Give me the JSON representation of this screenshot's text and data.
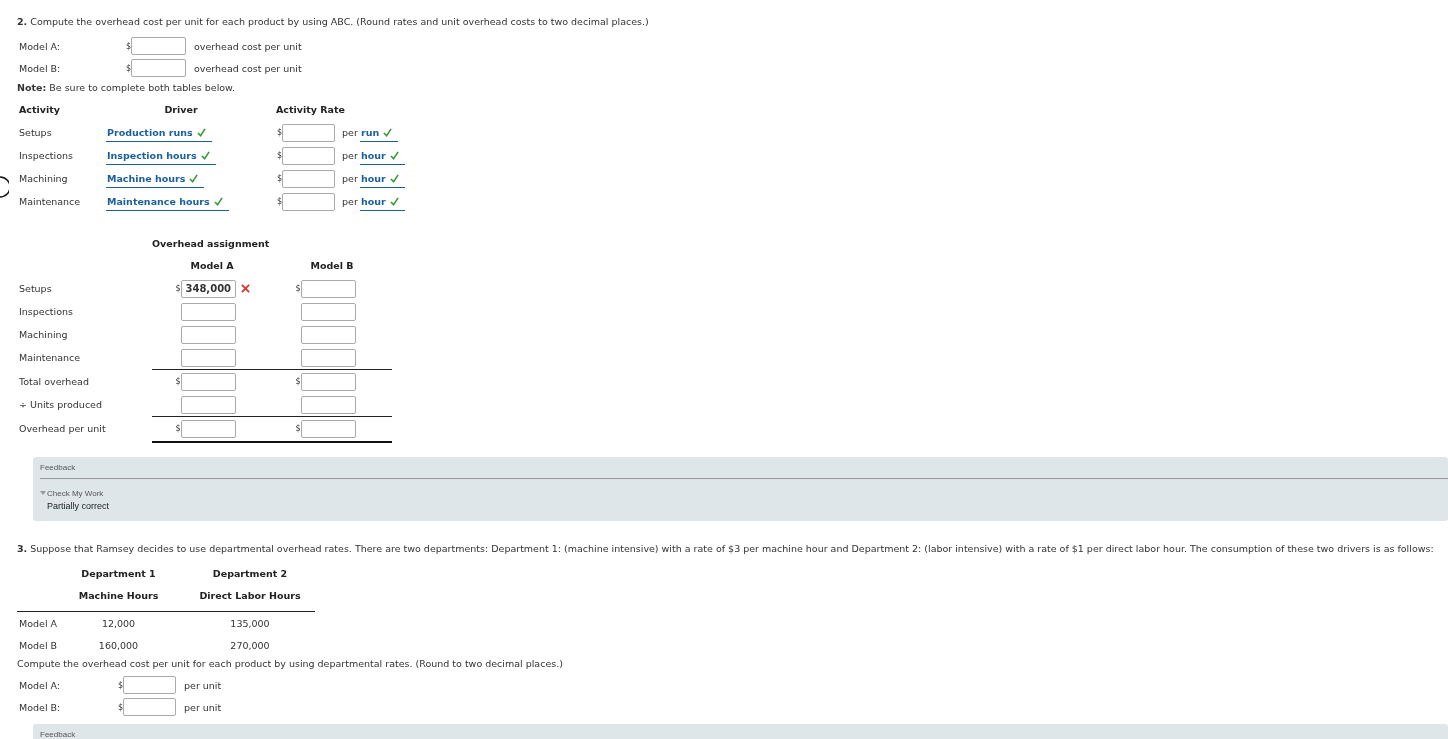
{
  "q2": {
    "prompt": "**2.** Compute the overhead cost per unit for each product by using ABC. (Round rates and unit overhead costs to two decimal places.)",
    "unit_costs": [
      {
        "label": "Model A:",
        "currency": "$",
        "suffix": "overhead cost per unit"
      },
      {
        "label": "Model B:",
        "currency": "$",
        "suffix": "overhead cost per unit"
      }
    ],
    "note": "**Note:** Be sure to complete both tables below.",
    "activity_table": {
      "columns": [
        "Activity",
        "Driver",
        "Activity Rate"
      ],
      "rows": [
        {
          "activity": "Setups",
          "driver": "Production runs",
          "driver_correct": true,
          "currency": "$",
          "per": "per",
          "unit": "run",
          "unit_correct": true
        },
        {
          "activity": "Inspections",
          "driver": "Inspection hours",
          "driver_correct": true,
          "currency": "$",
          "per": "per",
          "unit": "hour",
          "unit_correct": true
        },
        {
          "activity": "Machining",
          "driver": "Machine hours",
          "driver_correct": true,
          "currency": "$",
          "per": "per",
          "unit": "hour",
          "unit_correct": true
        },
        {
          "activity": "Maintenance",
          "driver": "Maintenance hours",
          "driver_correct": true,
          "currency": "$",
          "per": "per",
          "unit": "hour",
          "unit_correct": true
        }
      ]
    },
    "overhead_assignment": {
      "title": "Overhead assignment",
      "columns": [
        "Model A",
        "Model B"
      ],
      "rows": [
        {
          "label": "Setups",
          "rule_above": false,
          "cells": [
            {
              "currency": "$",
              "value": "348,000",
              "correct": false
            },
            {
              "currency": "$"
            }
          ]
        },
        {
          "label": "Inspections",
          "rule_above": false,
          "cells": [
            {},
            {}
          ]
        },
        {
          "label": "Machining",
          "rule_above": false,
          "cells": [
            {},
            {}
          ]
        },
        {
          "label": "Maintenance",
          "rule_above": false,
          "cells": [
            {},
            {}
          ]
        },
        {
          "label": "Total overhead",
          "rule_above": true,
          "cells": [
            {
              "currency": "$"
            },
            {
              "currency": "$"
            }
          ]
        },
        {
          "label": "÷ Units produced",
          "rule_above": false,
          "cells": [
            {},
            {}
          ]
        },
        {
          "label": "Overhead per unit",
          "rule_above": true,
          "cells": [
            {
              "currency": "$"
            },
            {
              "currency": "$"
            }
          ]
        }
      ]
    },
    "feedback": {
      "title": "Feedback",
      "toggle": "Check My Work",
      "expanded": true,
      "result": "Partially correct"
    }
  },
  "q3": {
    "prompt": "**3.** Suppose that Ramsey decides to use departmental overhead rates. There are two departments: Department 1: (machine intensive) with a rate of $3 per machine hour and Department 2: (labor intensive) with a rate of $1 per direct labor hour. The consumption of these two drivers is as follows:",
    "table": {
      "columns": [
        {
          "title": "Department 1",
          "subtitle": "Machine Hours"
        },
        {
          "title": "Department 2",
          "subtitle": "Direct Labor Hours"
        }
      ],
      "rows": [
        {
          "label": "Model A",
          "values": [
            "12,000",
            "135,000"
          ]
        },
        {
          "label": "Model B",
          "values": [
            "160,000",
            "270,000"
          ]
        }
      ]
    },
    "instruction": "Compute the overhead cost per unit for each product by using departmental rates. (Round to two decimal places.)",
    "unit_costs": [
      {
        "label": "Model A:",
        "currency": "$",
        "suffix": "per unit"
      },
      {
        "label": "Model B:",
        "currency": "$",
        "suffix": "per unit"
      }
    ],
    "feedback": {
      "title": "Feedback"
    }
  }
}
